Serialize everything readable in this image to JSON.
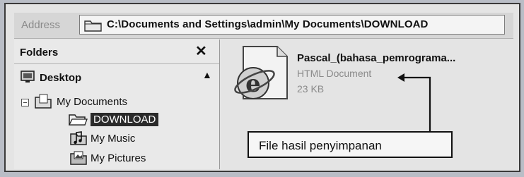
{
  "address_bar": {
    "label": "Address",
    "path": "C:\\Documents and Settings\\admin\\My Documents\\DOWNLOAD"
  },
  "folders_pane": {
    "title": "Folders",
    "items": [
      {
        "label": "Desktop",
        "icon": "desktop-icon"
      },
      {
        "label": "My Documents",
        "icon": "folder-documents-icon",
        "expanded": true
      },
      {
        "label": "DOWNLOAD",
        "icon": "folder-open-icon",
        "selected": true
      },
      {
        "label": "My Music",
        "icon": "folder-music-icon"
      },
      {
        "label": "My Pictures",
        "icon": "folder-pictures-icon"
      }
    ]
  },
  "file": {
    "name": "Pascal_(bahasa_pemrograma...",
    "type": "HTML Document",
    "size": "23 KB",
    "icon": "internet-explorer-html-icon"
  },
  "callout": {
    "text": "File hasil penyimpanan"
  }
}
